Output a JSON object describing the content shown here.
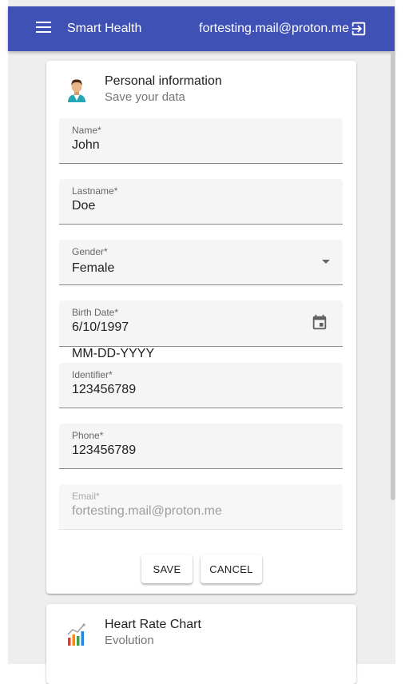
{
  "header": {
    "app_title": "Smart Health",
    "user_email": "fortesting.mail@proton.me"
  },
  "personal_card": {
    "title": "Personal information",
    "subtitle": "Save your data",
    "fields": {
      "name": {
        "label": "Name*",
        "value": "John"
      },
      "lastname": {
        "label": "Lastname*",
        "value": "Doe"
      },
      "gender": {
        "label": "Gender*",
        "value": "Female"
      },
      "birth_date": {
        "label": "Birth Date*",
        "value": "6/10/1997",
        "hint": "MM-DD-YYYY"
      },
      "identifier": {
        "label": "Identifier*",
        "value": "123456789"
      },
      "phone": {
        "label": "Phone*",
        "value": "123456789"
      },
      "email": {
        "label": "Email*",
        "value": "fortesting.mail@proton.me"
      }
    },
    "buttons": {
      "save": "SAVE",
      "cancel": "CANCEL"
    }
  },
  "chart_card": {
    "title": "Heart Rate Chart",
    "subtitle": "Evolution"
  },
  "colors": {
    "primary": "#3f51b5",
    "field_bg": "#f5f5f5"
  },
  "icons": [
    "menu-icon",
    "logout-icon",
    "user-avatar-icon",
    "calendar-icon",
    "dropdown-arrow-icon",
    "chart-icon"
  ]
}
